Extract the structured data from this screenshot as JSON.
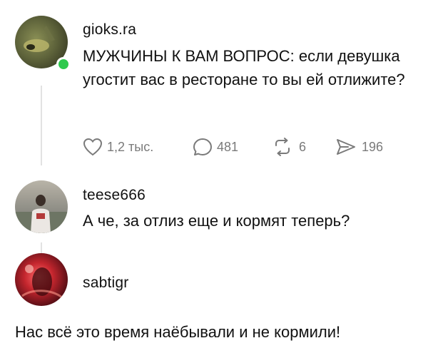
{
  "posts": [
    {
      "username": "gioks.ra",
      "text": "МУЖЧИНЫ К ВАМ ВОПРОС: если девушка угостит вас в ресторане то вы ей отлижите?",
      "online": true,
      "actions": {
        "likes": "1,2 тыс.",
        "comments": "481",
        "reposts": "6",
        "shares": "196"
      }
    },
    {
      "username": "teese666",
      "text": "А че, за отлиз еще и кормят теперь?"
    },
    {
      "username": "sabtigr",
      "text": "Нас всё это время наёбывали и не кормили!"
    }
  ],
  "colors": {
    "online": "#2ec94d",
    "icons": "#7a7a7a",
    "thread_line": "#e2e2e2"
  }
}
